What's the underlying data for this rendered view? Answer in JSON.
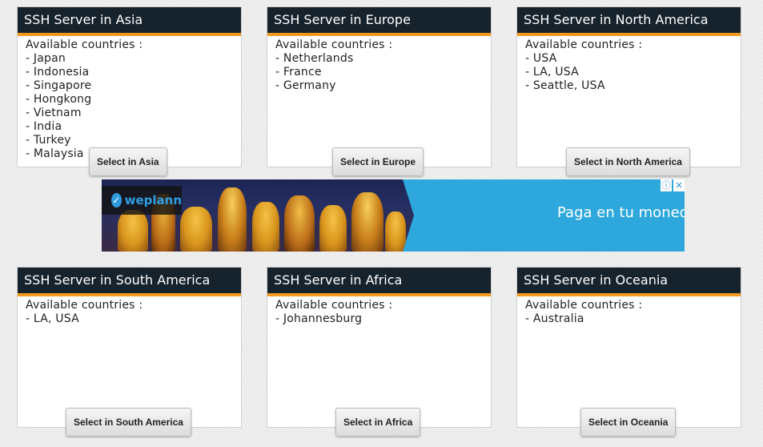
{
  "available_label": "Available countries :",
  "regions": [
    {
      "title": "SSH Server in Asia",
      "countries": [
        "- Japan",
        "- Indonesia",
        "- Singapore",
        "- Hongkong",
        "- Vietnam",
        "- India",
        "- Turkey",
        "- Malaysia"
      ],
      "button": "Select in Asia"
    },
    {
      "title": "SSH Server in Europe",
      "countries": [
        "- Netherlands",
        "- France",
        "- Germany"
      ],
      "button": "Select in Europe"
    },
    {
      "title": "SSH Server in North America",
      "countries": [
        "- USA",
        "- LA, USA",
        "- Seattle, USA"
      ],
      "button": "Select in North America"
    },
    {
      "title": "SSH Server in South America",
      "countries": [
        "- LA, USA"
      ],
      "button": "Select in South America"
    },
    {
      "title": "SSH Server in Africa",
      "countries": [
        "- Johannesburg"
      ],
      "button": "Select in Africa"
    },
    {
      "title": "SSH Server in Oceania",
      "countries": [
        "- Australia"
      ],
      "button": "Select in Oceania"
    }
  ],
  "ad": {
    "logo_text": "weplann",
    "headline": "Paga en tu moned",
    "info_icon": "info-icon",
    "close_icon": "close-icon"
  },
  "colors": {
    "header_bg": "#16222c",
    "header_accent": "#f39a1e",
    "ad_bg": "#2ea8dc"
  }
}
